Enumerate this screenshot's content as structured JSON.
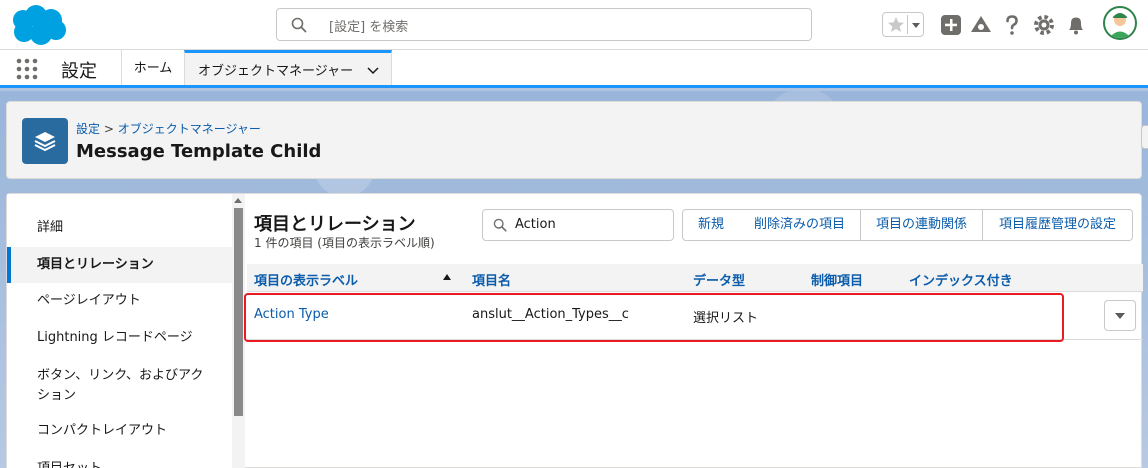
{
  "header": {
    "search_placeholder": "[設定] を検索",
    "icons": [
      "salesforce-logo",
      "search-icon",
      "star-icon",
      "chevron-down-icon",
      "plus-icon",
      "trailhead-icon",
      "help-icon",
      "gear-icon",
      "bell-icon",
      "avatar"
    ]
  },
  "context": {
    "app_name": "設定",
    "tabs": [
      {
        "label": "ホーム"
      },
      {
        "label": "オブジェクトマネージャー"
      }
    ]
  },
  "page_header": {
    "breadcrumb_link_1": "設定",
    "breadcrumb_sep": " > ",
    "breadcrumb_link_2": "オブジェクトマネージャー",
    "title": "Message Template Child"
  },
  "sidebar": {
    "items": [
      {
        "label": "詳細"
      },
      {
        "label": "項目とリレーション"
      },
      {
        "label": "ページレイアウト"
      },
      {
        "label": "Lightning レコードページ"
      },
      {
        "label": "ボタン、リンク、およびアクション"
      },
      {
        "label": "コンパクトレイアウト"
      },
      {
        "label": "項目セット"
      }
    ]
  },
  "content": {
    "title": "項目とリレーション",
    "subtitle": "1 件の項目 (項目の表示ラベル順)",
    "quick_find_value": "Action",
    "buttons": [
      {
        "label": "新規"
      },
      {
        "label": "削除済みの項目"
      },
      {
        "label": "項目の連動関係"
      },
      {
        "label": "項目履歴管理の設定"
      }
    ],
    "columns": [
      "項目の表示ラベル",
      "項目名",
      "データ型",
      "制御項目",
      "インデックス付き"
    ],
    "rows": [
      {
        "label": "Action Type",
        "api_name": "anslut__Action_Types__c",
        "data_type": "選択リスト",
        "controlling": "",
        "indexed": ""
      }
    ]
  },
  "colors": {
    "brand_blue": "#1b96ff",
    "link_blue": "#0b5cab",
    "highlight_red": "#e81b23",
    "object_icon": "#2a6b9f"
  }
}
